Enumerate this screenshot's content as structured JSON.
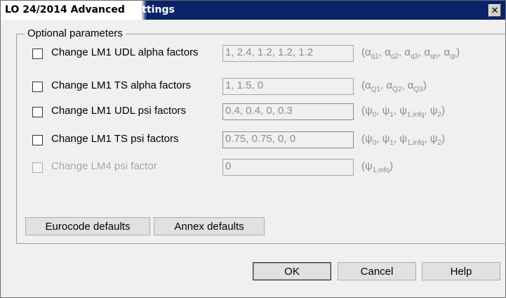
{
  "window": {
    "title_part1": "LO 24/2014 Advanced",
    "title_part2": " Settings",
    "close_glyph": "✕"
  },
  "group": {
    "legend": "Optional parameters"
  },
  "rows": [
    {
      "label": "Change LM1 UDL alpha factors",
      "value": "1, 2.4, 1.2, 1.2, 1.2",
      "hint": [
        [
          "(α",
          "q1"
        ],
        [
          ", α",
          "q2"
        ],
        [
          ", α",
          "q3"
        ],
        [
          ", α",
          "qn"
        ],
        [
          ", α",
          "qr"
        ],
        [
          ")",
          ""
        ]
      ],
      "checked": false,
      "enabled": true
    },
    {
      "label": "Change LM1 TS alpha factors",
      "value": "1, 1.5, 0",
      "hint": [
        [
          "(α",
          "Q1"
        ],
        [
          ", α",
          "Q2"
        ],
        [
          ", α",
          "Q3"
        ],
        [
          ")",
          ""
        ]
      ],
      "checked": false,
      "enabled": true
    },
    {
      "label": "Change LM1 UDL psi factors",
      "value": "0.4, 0.4, 0, 0.3",
      "hint": [
        [
          "(ψ",
          "0"
        ],
        [
          ", ψ",
          "1"
        ],
        [
          ", ψ",
          "1,infq"
        ],
        [
          ", ψ",
          "2"
        ],
        [
          ")",
          ""
        ]
      ],
      "checked": false,
      "enabled": true
    },
    {
      "label": "Change LM1 TS psi factors",
      "value": "0.75, 0.75, 0, 0",
      "hint": [
        [
          "(ψ",
          "0"
        ],
        [
          ", ψ",
          "1"
        ],
        [
          ", ψ",
          "1,infq"
        ],
        [
          ", ψ",
          "2"
        ],
        [
          ")",
          ""
        ]
      ],
      "checked": false,
      "enabled": true
    },
    {
      "label": "Change LM4 psi factor",
      "value": "0",
      "hint": [
        [
          "(ψ",
          "1,infq"
        ],
        [
          ")",
          ""
        ]
      ],
      "checked": false,
      "enabled": false
    }
  ],
  "buttons": {
    "eurocode": "Eurocode defaults",
    "annex": "Annex defaults",
    "ok": "OK",
    "cancel": "Cancel",
    "help": "Help"
  },
  "colors": {
    "titlebar": "#0a246a",
    "dialog_bg": "#f0f0f0",
    "disabled_text": "#8c8c8c"
  }
}
